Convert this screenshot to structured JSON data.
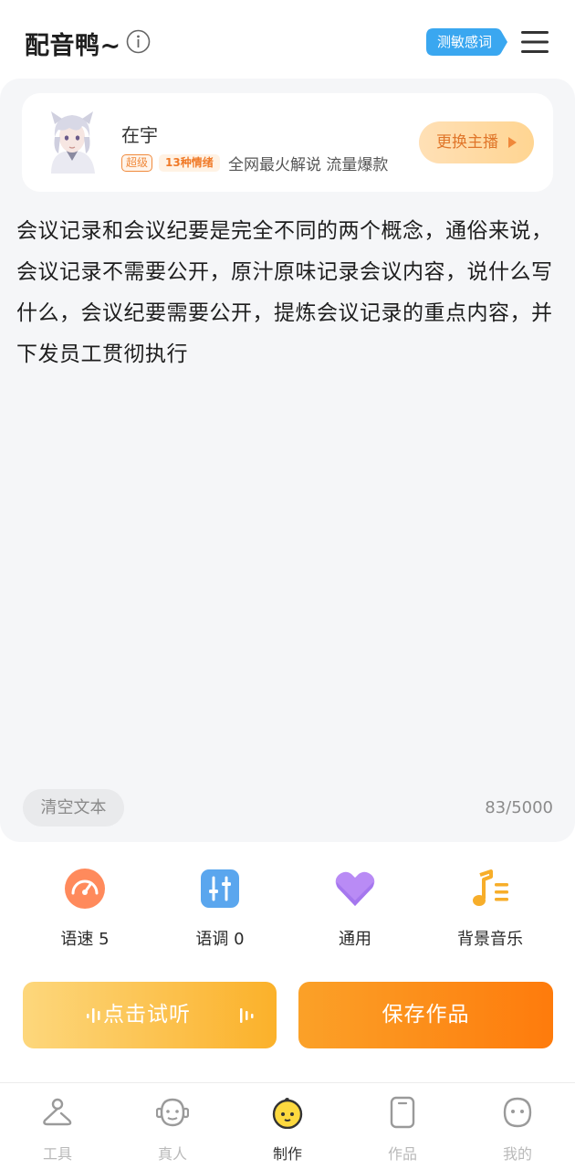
{
  "header": {
    "app_title": "配音鸭~",
    "sensitive_words_label": "测敏感词"
  },
  "voice": {
    "name": "在宇",
    "badge_level": "超级",
    "badge_emotions": "13种情绪",
    "description": "全网最火解说 流量爆款",
    "switch_label": "更换主播"
  },
  "editor": {
    "text": "会议记录和会议纪要是完全不同的两个概念，通俗来说，会议记录不需要公开，原汁原味记录会议内容，说什么写什么，会议纪要需要公开，提炼会议记录的重点内容，并下发员工贯彻执行",
    "clear_label": "清空文本",
    "char_count": "83/5000"
  },
  "controls": [
    {
      "label": "语速 5",
      "icon": "speedometer-icon"
    },
    {
      "label": "语调 0",
      "icon": "sliders-icon"
    },
    {
      "label": "通用",
      "icon": "heart-icon"
    },
    {
      "label": "背景音乐",
      "icon": "music-icon"
    }
  ],
  "actions": {
    "listen_label": "点击试听",
    "save_label": "保存作品"
  },
  "nav": [
    {
      "label": "工具",
      "icon": "hanger-icon"
    },
    {
      "label": "真人",
      "icon": "person-face-icon"
    },
    {
      "label": "制作",
      "icon": "duck-icon",
      "active": true
    },
    {
      "label": "作品",
      "icon": "phone-card-icon"
    },
    {
      "label": "我的",
      "icon": "profile-face-icon"
    }
  ],
  "colors": {
    "accent_orange": "#fe7b0c",
    "accent_yellow": "#fbb12a",
    "sensitive_blue": "#3aa7f0"
  }
}
